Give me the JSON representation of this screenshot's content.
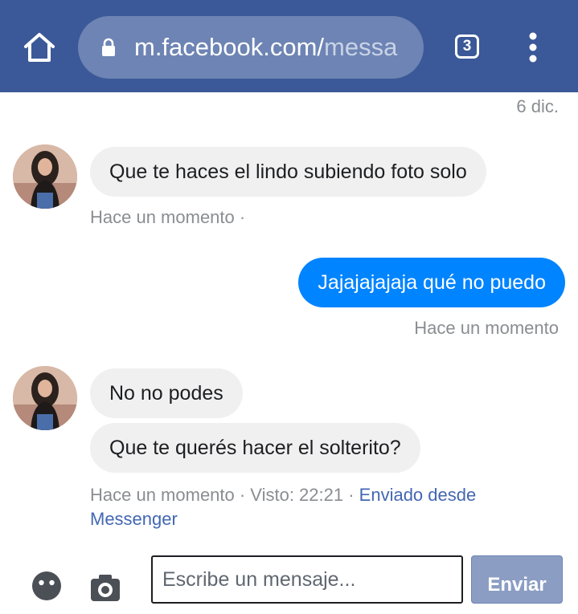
{
  "browser": {
    "url_domain": "m.facebook.com/",
    "url_path": "messa",
    "tab_count": "3",
    "bar_color": "#3b5998"
  },
  "chat": {
    "date_label": "6 dic.",
    "messages": [
      {
        "side": "in",
        "bubbles": [
          "Que te haces el lindo subiendo foto solo"
        ],
        "meta": "Hace un momento ·"
      },
      {
        "side": "out",
        "bubbles": [
          "Jajajajajaja qué no puedo"
        ],
        "meta": "Hace un momento"
      },
      {
        "side": "in",
        "bubbles": [
          "No no podes",
          "Que te querés hacer el solterito?"
        ],
        "meta_prefix": "Hace un momento · Visto: 22:21 · ",
        "meta_link_1": "Enviado desde",
        "meta_link_2": "Messenger"
      }
    ],
    "incoming_bubble_color": "#f1f0f0",
    "outgoing_bubble_color": "#0084ff"
  },
  "composer": {
    "placeholder": "Escribe un mensaje...",
    "send_label": "Enviar",
    "icons": [
      "emoji-icon",
      "camera-icon"
    ]
  }
}
